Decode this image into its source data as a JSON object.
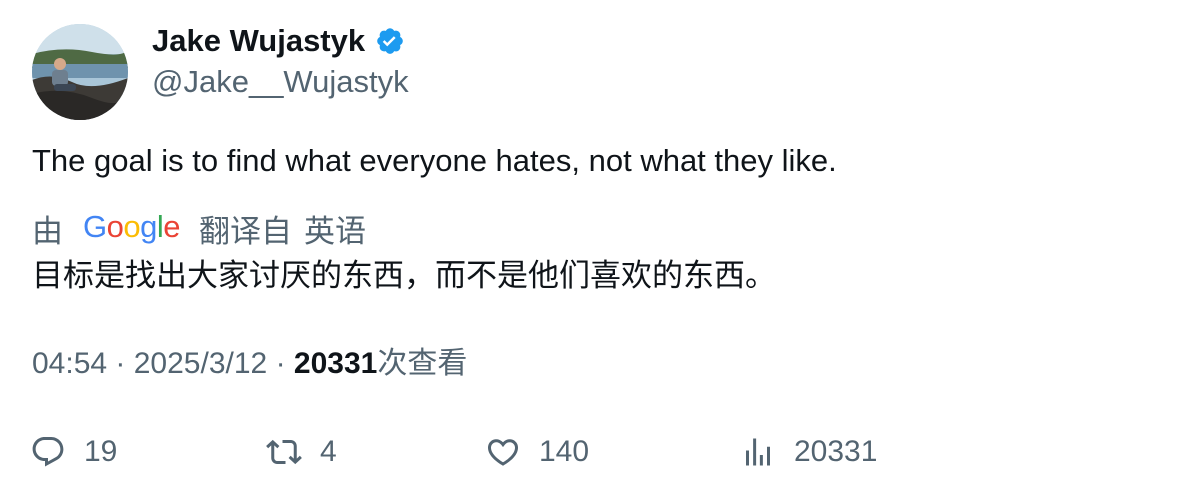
{
  "author": {
    "display_name": "Jake Wujastyk",
    "handle": "@Jake__Wujastyk",
    "verified": true,
    "verified_color": "#1d9bf0"
  },
  "tweet": {
    "text": "The goal is to find what everyone hates, not what they like."
  },
  "translation": {
    "by_label": "由",
    "provider_logo": "google-logo",
    "translated_from_label": "翻译自",
    "source_language": "英语",
    "text": "目标是找出大家讨厌的东西，而不是他们喜欢的东西。"
  },
  "meta": {
    "time": "04:54",
    "separator": "·",
    "date": "2025/3/12",
    "views_count": "20331",
    "views_label": "次查看"
  },
  "actions": {
    "replies": {
      "icon": "reply-icon",
      "count": "19"
    },
    "retweets": {
      "icon": "retweet-icon",
      "count": "4"
    },
    "likes": {
      "icon": "heart-icon",
      "count": "140"
    },
    "views": {
      "icon": "analytics-icon",
      "count": "20331"
    }
  },
  "colors": {
    "text_primary": "#0f1419",
    "text_secondary": "#536471",
    "verified_blue": "#1d9bf0"
  }
}
